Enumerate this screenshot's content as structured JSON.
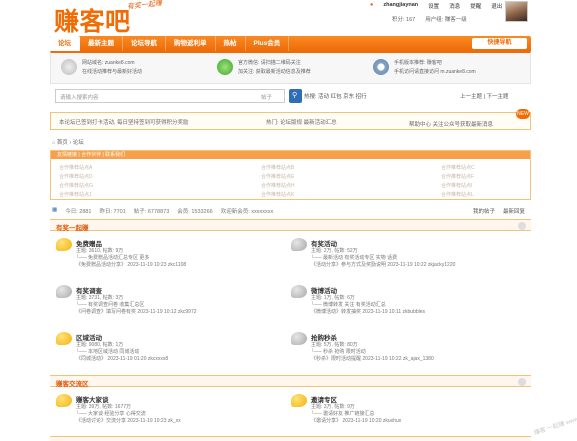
{
  "header": {
    "logo": "赚客吧",
    "slogan": "有奖一起赚",
    "username": "zhangjiaynan",
    "top_links": [
      "设置",
      "消息",
      "提醒",
      "退出"
    ],
    "stats_line": [
      "积分: 167",
      "用户组: 赚客一级"
    ]
  },
  "nav": {
    "items": [
      "论坛",
      "最新主题",
      "论坛导航",
      "购物返利单",
      "热帖",
      "Plus会员"
    ],
    "right": "快捷导航"
  },
  "info": {
    "blocks": [
      {
        "line1": "网站域名: zuanke8.com",
        "line2": "在线活动推荐与最新好活动"
      },
      {
        "line1": "官方微信: 请扫描二维码关注",
        "line2": "加关注: 获取最新活动信息及推荐"
      },
      {
        "line1": "手机版本推荐: 赚客吧",
        "line2": "手机访问请直接访问 m.zuanke8.com"
      }
    ]
  },
  "search": {
    "placeholder": "请输入搜索内容",
    "scope": "帖子",
    "hot": "热搜: 活动 红包 京东 招行",
    "right": "上一主题 | 下一主题"
  },
  "notice": {
    "left": "本论坛已签到打卡活动, 每日坚持签到可获得积分奖励",
    "mid": "热门: 论坛版规 最新活动汇总",
    "right": "帮助中心 关注公众号获取最新消息",
    "badge": "NEW"
  },
  "breadcrumb": "首页 › 论坛",
  "friend_links": {
    "head": "友情链接 | 合作伙伴 | 联系我们",
    "items": [
      "合作推荐站点A",
      "合作推荐站点B",
      "合作推荐站点C",
      "合作推荐站点D",
      "合作推荐站点E",
      "合作推荐站点F",
      "合作推荐站点G",
      "合作推荐站点H",
      "合作推荐站点I",
      "合作推荐站点J",
      "合作推荐站点K",
      "合作推荐站点L"
    ]
  },
  "stats": {
    "items": [
      "今日: 2881",
      "昨日: 7701",
      "帖子: 6778873",
      "会员: 1533266",
      "欢迎新会员: xxxxxxxx"
    ],
    "right": [
      "我的帖子",
      "最新回复"
    ]
  },
  "categories": [
    {
      "title": "有奖一起赚",
      "forums": [
        {
          "name": "免费赠品",
          "icon": "orange",
          "stats": "主题: 3610, 帖数: 9万",
          "l2": "└── 免费赠品活动汇总专区 更多",
          "l3": "《免费赠品活动分享》  2023-11-19 10:23 zkc1108"
        },
        {
          "name": "有奖活动",
          "icon": "gray",
          "stats": "主题: 2万, 帖数: 52万",
          "l2": "└── 最新活动 有奖活动专区 实物 话费",
          "l3": "《活动分享》参与方式及奖励说明  2023-11-19 10:22 zkjacky1220"
        },
        {
          "name": "有奖调查",
          "icon": "gray",
          "stats": "主题: 3731, 帖数: 3万",
          "l2": "└── 有奖调查问卷 收集汇总区",
          "l3": "《问卷调查》填写问卷有奖  2023-11-19 10:12 zkc9972"
        },
        {
          "name": "微博活动",
          "icon": "gray",
          "stats": "主题: 1万, 帖数: 6万",
          "l2": "└── 微博转发 关注 有奖活动汇总",
          "l3": "《微博活动》转发抽奖  2023-11-19 10:11 zkbubbles"
        },
        {
          "name": "区域活动",
          "icon": "orange",
          "stats": "主题: 9080, 帖数: 1万",
          "l2": "└── 本地区域活动 同城活动",
          "l3": "《同城活动》  2023-11-19 01:20 zkcxxxx8"
        },
        {
          "name": "抢购秒杀",
          "icon": "gray",
          "stats": "主题: 5万, 帖数: 80万",
          "l2": "└── 秒杀 抢购 限时活动",
          "l3": "《秒杀》限时活动提醒  2023-11-19 10:22 zk_ajax_1380"
        }
      ]
    },
    {
      "title": "赚客交流区",
      "forums": [
        {
          "name": "赚客大家谈",
          "icon": "orange",
          "stats": "主题: 39万, 帖数: 1677万",
          "l2": "└── 大家谈 经验分享 心得交流",
          "l3": "《活动讨论》交流分享  2023-11-19 10:23 zk_xx"
        },
        {
          "name": "邀请专区",
          "icon": "orange",
          "stats": "主题: 3万, 帖数: 9万",
          "l2": "└── 邀请好友 推广链接汇总",
          "l3": "《邀请分享》  2023-11-19 10:20 zkuxhux"
        }
      ]
    }
  ],
  "watermark": "赚客 一起赚\nwww.zuanke8.com"
}
